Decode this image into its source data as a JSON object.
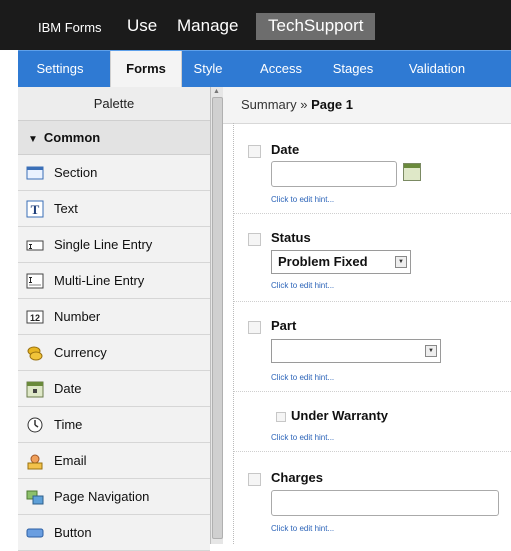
{
  "topbar": {
    "brand": "IBM Forms",
    "nav": [
      "Use",
      "Manage",
      "TechSupport"
    ],
    "active_nav": "TechSupport"
  },
  "tabs": [
    "Settings",
    "Forms",
    "Style",
    "Access",
    "Stages",
    "Validation"
  ],
  "active_tab": "Forms",
  "palette": {
    "title": "Palette",
    "group": "Common",
    "items": [
      {
        "label": "Section",
        "icon": "section-icon"
      },
      {
        "label": "Text",
        "icon": "text-icon"
      },
      {
        "label": "Single Line Entry",
        "icon": "single-line-entry-icon"
      },
      {
        "label": "Multi-Line Entry",
        "icon": "multi-line-entry-icon"
      },
      {
        "label": "Number",
        "icon": "number-icon"
      },
      {
        "label": "Currency",
        "icon": "currency-icon"
      },
      {
        "label": "Date",
        "icon": "date-icon"
      },
      {
        "label": "Time",
        "icon": "time-icon"
      },
      {
        "label": "Email",
        "icon": "email-icon"
      },
      {
        "label": "Page Navigation",
        "icon": "page-navigation-icon"
      },
      {
        "label": "Button",
        "icon": "button-icon"
      }
    ]
  },
  "breadcrumb": {
    "prefix": "Summary » ",
    "current": "Page 1"
  },
  "form": {
    "date_label": "Date",
    "status_label": "Status",
    "status_value": "Problem Fixed",
    "part_label": "Part",
    "warranty_label": "Under Warranty",
    "charges_label": "Charges",
    "hint": "Click to edit hint..."
  },
  "colors": {
    "topbar": "#1b1b1b",
    "tabbar": "#2f7ad3",
    "hint": "#2b63b8"
  }
}
